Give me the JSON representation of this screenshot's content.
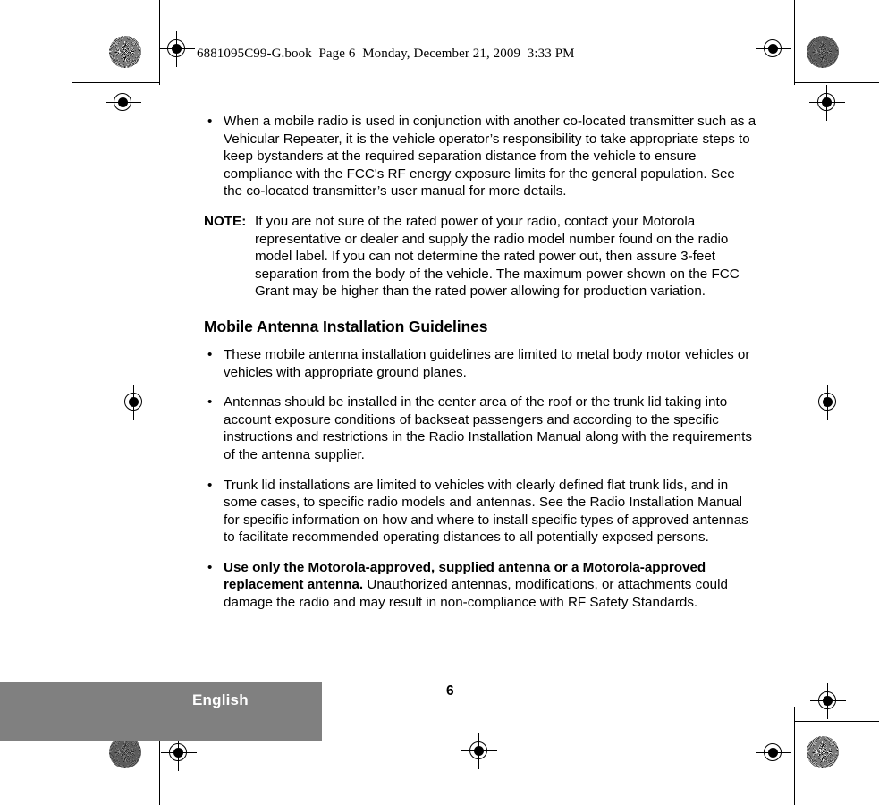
{
  "document": {
    "book_header": "6881095C99-G.book  Page 6  Monday, December 21, 2009  3:33 PM",
    "page_number": "6",
    "language_label": "English",
    "footer_bar_color": "#808080"
  },
  "content": {
    "bullet_1": {
      "marker": "•",
      "text": "When a mobile radio is used in conjunction with another co-located transmitter such as a Vehicular Repeater, it is the vehicle operator’s responsibility to take appropriate steps to keep bystanders at the required separation distance from the vehicle to ensure compliance with the FCC's RF energy exposure limits for the general population. See the co-located transmitter’s user manual for more details."
    },
    "note": {
      "label": "NOTE:",
      "text": "If you are not sure of the rated power of your radio, contact your Motorola representative or dealer and supply the radio model number found on the radio model label. If you can not determine the rated power out, then assure 3-feet separation from the body of the vehicle. The maximum power shown on the FCC Grant may be higher than the rated power allowing for production variation."
    },
    "section_heading": "Mobile Antenna Installation Guidelines",
    "bullet_2": {
      "marker": "•",
      "text": "These mobile antenna installation guidelines are limited to metal body motor vehicles or vehicles with appropriate ground planes."
    },
    "bullet_3": {
      "marker": "•",
      "text": "Antennas should be installed in the center area of the roof or the trunk lid taking into account exposure conditions of backseat passengers and according to the specific instructions and restrictions in the Radio Installation Manual along with the requirements of the antenna supplier."
    },
    "bullet_4": {
      "marker": "•",
      "text": "Trunk lid installations are limited to vehicles with clearly defined flat trunk lids, and in some cases, to specific radio models and antennas. See the Radio Installation Manual for specific information on how and where to install specific types of approved antennas to facilitate recommended operating distances to all potentially exposed persons."
    },
    "bullet_5": {
      "marker": "•",
      "bold_text": "Use only the Motorola-approved, supplied antenna or a Motorola-approved replacement antenna.",
      "text": " Unauthorized antennas, modifications, or attachments could damage the radio and may result in non-compliance with RF Safety Standards."
    }
  }
}
